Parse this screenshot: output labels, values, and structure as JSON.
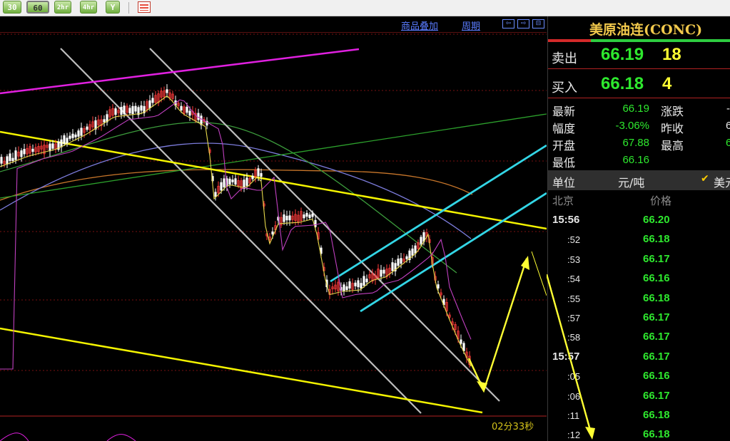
{
  "toolbar": {
    "buttons": [
      "30",
      "60",
      "2hr",
      "4hr",
      "Y"
    ],
    "active": "60"
  },
  "chart_header": {
    "overlay_link": "商品叠加",
    "period_link": "周期",
    "nav_icons": [
      "arrow-left-icon",
      "arrow-right-icon",
      "collapse-icon"
    ]
  },
  "chart": {
    "countdown": "02分33秒"
  },
  "panel": {
    "title": "美原油连(CONC)",
    "sell_label": "卖出",
    "sell_price": "66.19",
    "sell_volume": "18",
    "buy_label": "买入",
    "buy_price": "66.18",
    "buy_volume": "4",
    "stats": {
      "latest_label": "最新",
      "latest": "66.19",
      "change_label": "涨跌",
      "change": "-",
      "range_label": "幅度",
      "range": "-3.06%",
      "prev_close_label": "昨收",
      "prev_close": "6",
      "open_label": "开盘",
      "open": "67.88",
      "high_label": "最高",
      "high": "6",
      "low_label": "最低",
      "low": "66.16"
    },
    "unit_label": "单位",
    "unit_value": "元/吨",
    "unit_extra": "美元",
    "ticks_header_time": "北京",
    "ticks_header_price": "价格",
    "ticks": [
      {
        "time": "15:56",
        "price": "66.20"
      },
      {
        "time": ":52",
        "price": "66.18"
      },
      {
        "time": ":53",
        "price": "66.17"
      },
      {
        "time": ":54",
        "price": "66.16"
      },
      {
        "time": ":55",
        "price": "66.18"
      },
      {
        "time": ":57",
        "price": "66.17"
      },
      {
        "time": ":58",
        "price": "66.17"
      },
      {
        "time": "15:57",
        "price": "66.17"
      },
      {
        "time": ":05",
        "price": "66.16"
      },
      {
        "time": ":06",
        "price": "66.17"
      },
      {
        "time": ":11",
        "price": "66.18"
      },
      {
        "time": ":12",
        "price": "66.18"
      }
    ]
  },
  "colors": {
    "up": "#ff3b3b",
    "down": "#ffffff",
    "price_green": "#2ee82e",
    "trend_yellow": "#f4f400",
    "channel_cyan": "#33d6e6",
    "channel_gray": "#bdbdbd",
    "magenta": "#e020e0"
  }
}
